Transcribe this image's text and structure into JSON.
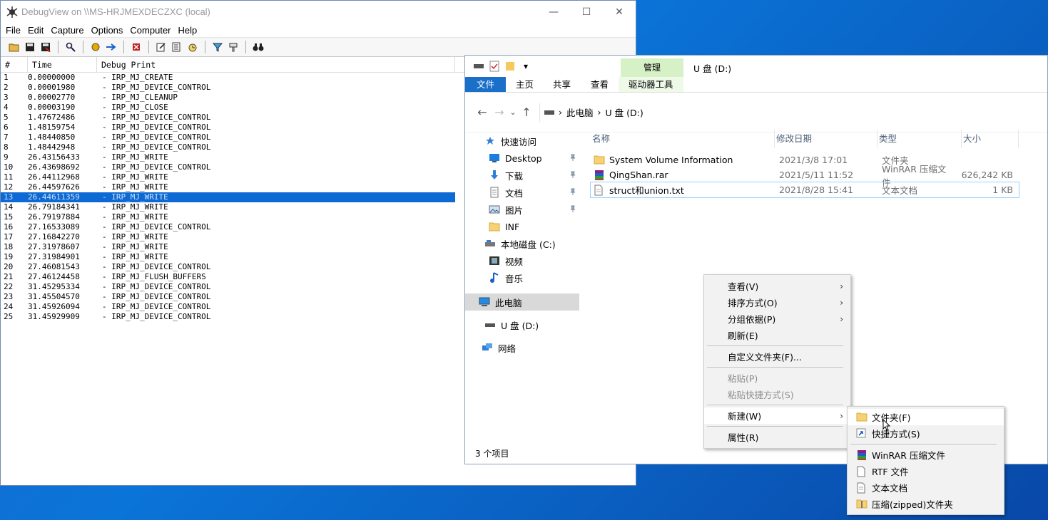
{
  "debugview": {
    "title": "DebugView on \\\\MS-HRJMEXDECZXC (local)",
    "menu": [
      "File",
      "Edit",
      "Capture",
      "Options",
      "Computer",
      "Help"
    ],
    "columns": {
      "num": "#",
      "time": "Time",
      "print": "Debug Print"
    },
    "selected_row": 13,
    "rows": [
      [
        "1",
        "0.00000000",
        "- IRP_MJ_CREATE"
      ],
      [
        "2",
        "0.00001980",
        "- IRP_MJ_DEVICE_CONTROL"
      ],
      [
        "3",
        "0.00002770",
        "- IRP_MJ_CLEANUP"
      ],
      [
        "4",
        "0.00003190",
        "- IRP_MJ_CLOSE"
      ],
      [
        "5",
        "1.47672486",
        "- IRP_MJ_DEVICE_CONTROL"
      ],
      [
        "6",
        "1.48159754",
        "- IRP_MJ_DEVICE_CONTROL"
      ],
      [
        "7",
        "1.48440850",
        "- IRP_MJ_DEVICE_CONTROL"
      ],
      [
        "8",
        "1.48442948",
        "- IRP_MJ_DEVICE_CONTROL"
      ],
      [
        "9",
        "26.43156433",
        "- IRP_MJ_WRITE"
      ],
      [
        "10",
        "26.43698692",
        "- IRP_MJ_DEVICE_CONTROL"
      ],
      [
        "11",
        "26.44112968",
        "- IRP_MJ_WRITE"
      ],
      [
        "12",
        "26.44597626",
        "- IRP_MJ_WRITE"
      ],
      [
        "13",
        "26.44611359",
        "- IRP_MJ_WRITE"
      ],
      [
        "14",
        "26.79184341",
        "- IRP_MJ_WRITE"
      ],
      [
        "15",
        "26.79197884",
        "- IRP_MJ_WRITE"
      ],
      [
        "16",
        "27.16533089",
        "- IRP_MJ_DEVICE_CONTROL"
      ],
      [
        "17",
        "27.16842270",
        "- IRP_MJ_WRITE"
      ],
      [
        "18",
        "27.31978607",
        "- IRP_MJ_WRITE"
      ],
      [
        "19",
        "27.31984901",
        "- IRP_MJ_WRITE"
      ],
      [
        "20",
        "27.46081543",
        "- IRP_MJ_DEVICE_CONTROL"
      ],
      [
        "21",
        "27.46124458",
        "- IRP_MJ_FLUSH_BUFFERS"
      ],
      [
        "22",
        "31.45295334",
        "- IRP_MJ_DEVICE_CONTROL"
      ],
      [
        "23",
        "31.45504570",
        "- IRP_MJ_DEVICE_CONTROL"
      ],
      [
        "24",
        "31.45926094",
        "- IRP_MJ_DEVICE_CONTROL"
      ],
      [
        "25",
        "31.45929909",
        "- IRP_MJ_DEVICE_CONTROL"
      ]
    ]
  },
  "explorer": {
    "title": "U 盘 (D:)",
    "manage_tab": "管理",
    "ribbon_tabs": [
      "文件",
      "主页",
      "共享",
      "查看",
      "驱动器工具"
    ],
    "breadcrumb": [
      "此电脑",
      "U 盘 (D:)"
    ],
    "nav_items": [
      {
        "label": "快速访问",
        "icon": "star-icon"
      },
      {
        "label": "Desktop",
        "icon": "desktop-icon",
        "pinned": true
      },
      {
        "label": "下载",
        "icon": "download-icon",
        "pinned": true
      },
      {
        "label": "文档",
        "icon": "document-icon",
        "pinned": true
      },
      {
        "label": "图片",
        "icon": "picture-icon",
        "pinned": true
      },
      {
        "label": "INF",
        "icon": "folder-icon"
      },
      {
        "label": "本地磁盘 (C:)",
        "icon": "drive-icon"
      },
      {
        "label": "视频",
        "icon": "video-icon"
      },
      {
        "label": "音乐",
        "icon": "music-icon"
      },
      {
        "label": "此电脑",
        "icon": "computer-icon",
        "selected": true
      },
      {
        "label": "U 盘 (D:)",
        "icon": "usb-drive-icon"
      },
      {
        "label": "网络",
        "icon": "network-icon"
      }
    ],
    "columns": {
      "name": "名称",
      "date": "修改日期",
      "type": "类型",
      "size": "大小"
    },
    "files": [
      {
        "name": "System Volume Information",
        "date": "2021/3/8 17:01",
        "type": "文件夹",
        "size": "",
        "icon": "folder-icon"
      },
      {
        "name": "QingShan.rar",
        "date": "2021/5/11 11:52",
        "type": "WinRAR 压缩文件",
        "size": "626,242 KB",
        "icon": "winrar-icon"
      },
      {
        "name": "struct和union.txt",
        "date": "2021/8/28 15:41",
        "type": "文本文档",
        "size": "1 KB",
        "icon": "text-file-icon"
      }
    ],
    "status": "3 个项目"
  },
  "context_menu": {
    "items": [
      {
        "label": "查看(V)",
        "submenu": true
      },
      {
        "label": "排序方式(O)",
        "submenu": true
      },
      {
        "label": "分组依据(P)",
        "submenu": true
      },
      {
        "label": "刷新(E)"
      },
      {
        "separator": true
      },
      {
        "label": "自定义文件夹(F)..."
      },
      {
        "separator": true
      },
      {
        "label": "粘贴(P)",
        "disabled": true
      },
      {
        "label": "粘贴快捷方式(S)",
        "disabled": true
      },
      {
        "separator": true
      },
      {
        "label": "新建(W)",
        "submenu": true,
        "highlighted": true
      },
      {
        "separator": true
      },
      {
        "label": "属性(R)"
      }
    ]
  },
  "new_submenu": {
    "items": [
      {
        "label": "文件夹(F)",
        "icon": "folder-icon",
        "highlighted": true
      },
      {
        "label": "快捷方式(S)",
        "icon": "shortcut-icon"
      },
      {
        "separator": true
      },
      {
        "label": "WinRAR 压缩文件",
        "icon": "winrar-icon"
      },
      {
        "label": "RTF 文件",
        "icon": "rtf-file-icon"
      },
      {
        "label": "文本文档",
        "icon": "text-file-icon"
      },
      {
        "label": "压缩(zipped)文件夹",
        "icon": "zip-folder-icon"
      }
    ]
  }
}
